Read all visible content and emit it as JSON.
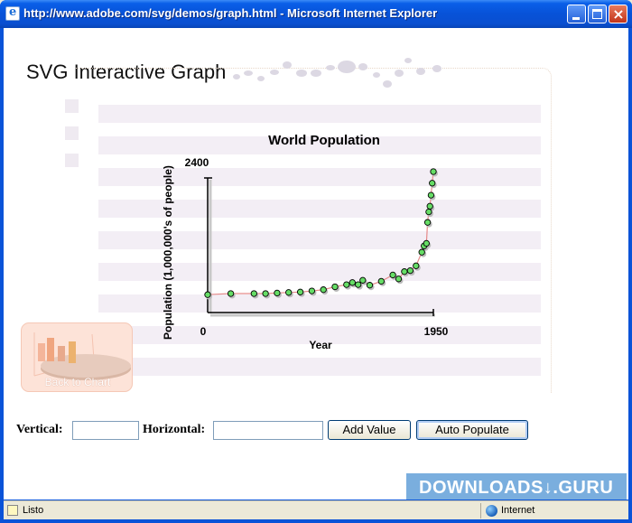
{
  "window": {
    "title": "http://www.adobe.com/svg/demos/graph.html - Microsoft Internet Explorer",
    "icon": "ie-page-icon",
    "buttons": [
      "minimize",
      "maximize",
      "close"
    ]
  },
  "page": {
    "title": "SVG Interactive Graph",
    "back_button": {
      "label": "Back to Chart",
      "icon": "pie-bar-chart-icon"
    }
  },
  "chart_data": {
    "type": "line",
    "title": "World Population",
    "xlabel": "Year",
    "ylabel": "Population (1,000,000's of people)",
    "x_tick_labels": [
      "0",
      "1950"
    ],
    "y_tick_labels": [
      "2400"
    ],
    "xlim": [
      0,
      1950
    ],
    "ylim": [
      0,
      2400
    ],
    "x": [
      0,
      200,
      400,
      500,
      600,
      700,
      800,
      900,
      1000,
      1100,
      1200,
      1250,
      1300,
      1340,
      1400,
      1500,
      1600,
      1650,
      1700,
      1750,
      1800,
      1850,
      1870,
      1890,
      1900,
      1910,
      1920,
      1930,
      1940,
      1950
    ],
    "y": [
      170,
      190,
      190,
      190,
      200,
      210,
      220,
      240,
      265,
      320,
      360,
      400,
      360,
      443,
      350,
      425,
      545,
      470,
      610,
      629,
      720,
      980,
      1100,
      1150,
      1550,
      1750,
      1860,
      2070,
      2300,
      2520
    ],
    "line_color": "#e58a8a",
    "point_color": "#66dd66",
    "grid": false,
    "legend": "none"
  },
  "form": {
    "vertical_label": "Vertical:",
    "vertical_value": "",
    "horizontal_label": "Horizontal:",
    "horizontal_value": "",
    "add_button": "Add Value",
    "auto_button": "Auto Populate"
  },
  "statusbar": {
    "status": "Listo",
    "zone": "Internet"
  },
  "watermark": "DOWNLOADS↓.GURU",
  "colors": {
    "titlebar": "#0a53d8",
    "stripe": "#f3eef5",
    "back_button_bg": "#fde3d8",
    "watermark_bg": "#6fa8dc"
  }
}
